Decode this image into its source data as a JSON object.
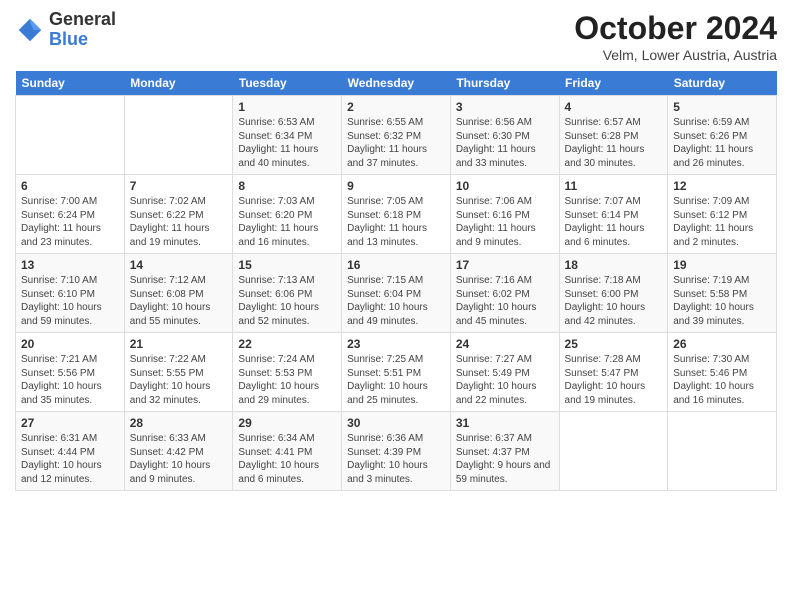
{
  "logo": {
    "general": "General",
    "blue": "Blue"
  },
  "header": {
    "month": "October 2024",
    "location": "Velm, Lower Austria, Austria"
  },
  "weekdays": [
    "Sunday",
    "Monday",
    "Tuesday",
    "Wednesday",
    "Thursday",
    "Friday",
    "Saturday"
  ],
  "weeks": [
    [
      {
        "day": "",
        "content": ""
      },
      {
        "day": "",
        "content": ""
      },
      {
        "day": "1",
        "content": "Sunrise: 6:53 AM\nSunset: 6:34 PM\nDaylight: 11 hours and 40 minutes."
      },
      {
        "day": "2",
        "content": "Sunrise: 6:55 AM\nSunset: 6:32 PM\nDaylight: 11 hours and 37 minutes."
      },
      {
        "day": "3",
        "content": "Sunrise: 6:56 AM\nSunset: 6:30 PM\nDaylight: 11 hours and 33 minutes."
      },
      {
        "day": "4",
        "content": "Sunrise: 6:57 AM\nSunset: 6:28 PM\nDaylight: 11 hours and 30 minutes."
      },
      {
        "day": "5",
        "content": "Sunrise: 6:59 AM\nSunset: 6:26 PM\nDaylight: 11 hours and 26 minutes."
      }
    ],
    [
      {
        "day": "6",
        "content": "Sunrise: 7:00 AM\nSunset: 6:24 PM\nDaylight: 11 hours and 23 minutes."
      },
      {
        "day": "7",
        "content": "Sunrise: 7:02 AM\nSunset: 6:22 PM\nDaylight: 11 hours and 19 minutes."
      },
      {
        "day": "8",
        "content": "Sunrise: 7:03 AM\nSunset: 6:20 PM\nDaylight: 11 hours and 16 minutes."
      },
      {
        "day": "9",
        "content": "Sunrise: 7:05 AM\nSunset: 6:18 PM\nDaylight: 11 hours and 13 minutes."
      },
      {
        "day": "10",
        "content": "Sunrise: 7:06 AM\nSunset: 6:16 PM\nDaylight: 11 hours and 9 minutes."
      },
      {
        "day": "11",
        "content": "Sunrise: 7:07 AM\nSunset: 6:14 PM\nDaylight: 11 hours and 6 minutes."
      },
      {
        "day": "12",
        "content": "Sunrise: 7:09 AM\nSunset: 6:12 PM\nDaylight: 11 hours and 2 minutes."
      }
    ],
    [
      {
        "day": "13",
        "content": "Sunrise: 7:10 AM\nSunset: 6:10 PM\nDaylight: 10 hours and 59 minutes."
      },
      {
        "day": "14",
        "content": "Sunrise: 7:12 AM\nSunset: 6:08 PM\nDaylight: 10 hours and 55 minutes."
      },
      {
        "day": "15",
        "content": "Sunrise: 7:13 AM\nSunset: 6:06 PM\nDaylight: 10 hours and 52 minutes."
      },
      {
        "day": "16",
        "content": "Sunrise: 7:15 AM\nSunset: 6:04 PM\nDaylight: 10 hours and 49 minutes."
      },
      {
        "day": "17",
        "content": "Sunrise: 7:16 AM\nSunset: 6:02 PM\nDaylight: 10 hours and 45 minutes."
      },
      {
        "day": "18",
        "content": "Sunrise: 7:18 AM\nSunset: 6:00 PM\nDaylight: 10 hours and 42 minutes."
      },
      {
        "day": "19",
        "content": "Sunrise: 7:19 AM\nSunset: 5:58 PM\nDaylight: 10 hours and 39 minutes."
      }
    ],
    [
      {
        "day": "20",
        "content": "Sunrise: 7:21 AM\nSunset: 5:56 PM\nDaylight: 10 hours and 35 minutes."
      },
      {
        "day": "21",
        "content": "Sunrise: 7:22 AM\nSunset: 5:55 PM\nDaylight: 10 hours and 32 minutes."
      },
      {
        "day": "22",
        "content": "Sunrise: 7:24 AM\nSunset: 5:53 PM\nDaylight: 10 hours and 29 minutes."
      },
      {
        "day": "23",
        "content": "Sunrise: 7:25 AM\nSunset: 5:51 PM\nDaylight: 10 hours and 25 minutes."
      },
      {
        "day": "24",
        "content": "Sunrise: 7:27 AM\nSunset: 5:49 PM\nDaylight: 10 hours and 22 minutes."
      },
      {
        "day": "25",
        "content": "Sunrise: 7:28 AM\nSunset: 5:47 PM\nDaylight: 10 hours and 19 minutes."
      },
      {
        "day": "26",
        "content": "Sunrise: 7:30 AM\nSunset: 5:46 PM\nDaylight: 10 hours and 16 minutes."
      }
    ],
    [
      {
        "day": "27",
        "content": "Sunrise: 6:31 AM\nSunset: 4:44 PM\nDaylight: 10 hours and 12 minutes."
      },
      {
        "day": "28",
        "content": "Sunrise: 6:33 AM\nSunset: 4:42 PM\nDaylight: 10 hours and 9 minutes."
      },
      {
        "day": "29",
        "content": "Sunrise: 6:34 AM\nSunset: 4:41 PM\nDaylight: 10 hours and 6 minutes."
      },
      {
        "day": "30",
        "content": "Sunrise: 6:36 AM\nSunset: 4:39 PM\nDaylight: 10 hours and 3 minutes."
      },
      {
        "day": "31",
        "content": "Sunrise: 6:37 AM\nSunset: 4:37 PM\nDaylight: 9 hours and 59 minutes."
      },
      {
        "day": "",
        "content": ""
      },
      {
        "day": "",
        "content": ""
      }
    ]
  ]
}
